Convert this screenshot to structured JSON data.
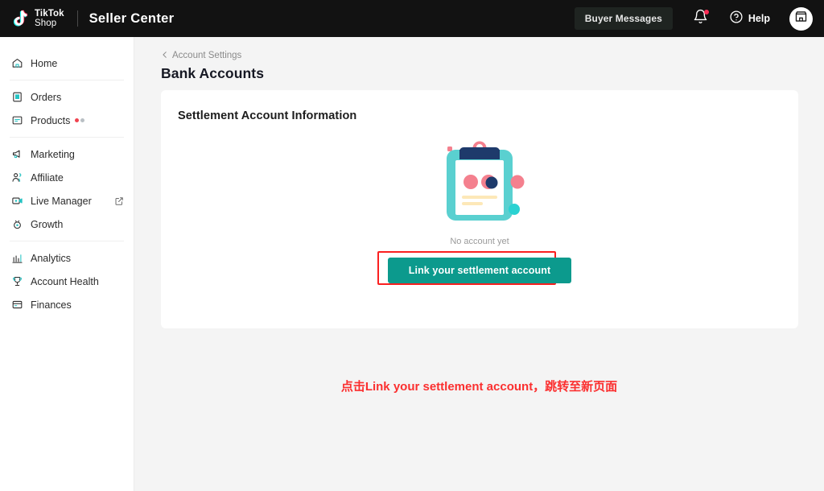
{
  "topbar": {
    "brand_line1": "TikTok",
    "brand_line2": "Shop",
    "app_name": "Seller Center",
    "buyer_messages_label": "Buyer Messages",
    "bell_icon": "bell-icon",
    "help_label": "Help",
    "help_icon": "question-circle-icon",
    "shop_avatar_icon": "store-icon",
    "bar_color": "#121212"
  },
  "sidebar": {
    "groups": [
      {
        "items": [
          {
            "label": "Home",
            "icon": "home-icon"
          }
        ]
      },
      {
        "items": [
          {
            "label": "Orders",
            "icon": "clipboard-icon"
          },
          {
            "label": "Products",
            "icon": "box-icon",
            "badge": "dots"
          }
        ]
      },
      {
        "items": [
          {
            "label": "Marketing",
            "icon": "megaphone-icon"
          },
          {
            "label": "Affiliate",
            "icon": "people-icon"
          },
          {
            "label": "Live Manager",
            "icon": "video-icon",
            "external": "external-link-icon"
          },
          {
            "label": "Growth",
            "icon": "growth-icon"
          }
        ]
      },
      {
        "items": [
          {
            "label": "Analytics",
            "icon": "bar-chart-icon"
          },
          {
            "label": "Account Health",
            "icon": "trophy-icon"
          },
          {
            "label": "Finances",
            "icon": "wallet-icon"
          }
        ]
      }
    ]
  },
  "main": {
    "breadcrumb": "Account Settings",
    "breadcrumb_icon": "chevron-left-icon",
    "page_title": "Bank Accounts",
    "card_title": "Settlement Account Information",
    "empty_illustration": "clipboard-empty-illustration",
    "empty_text": "No account yet",
    "cta_label": "Link your settlement account",
    "cta_color": "#0c9a8d",
    "annotation_text": "点击Link your settlement account，跳转至新页面",
    "annotation_color": "#fb2f2f"
  }
}
